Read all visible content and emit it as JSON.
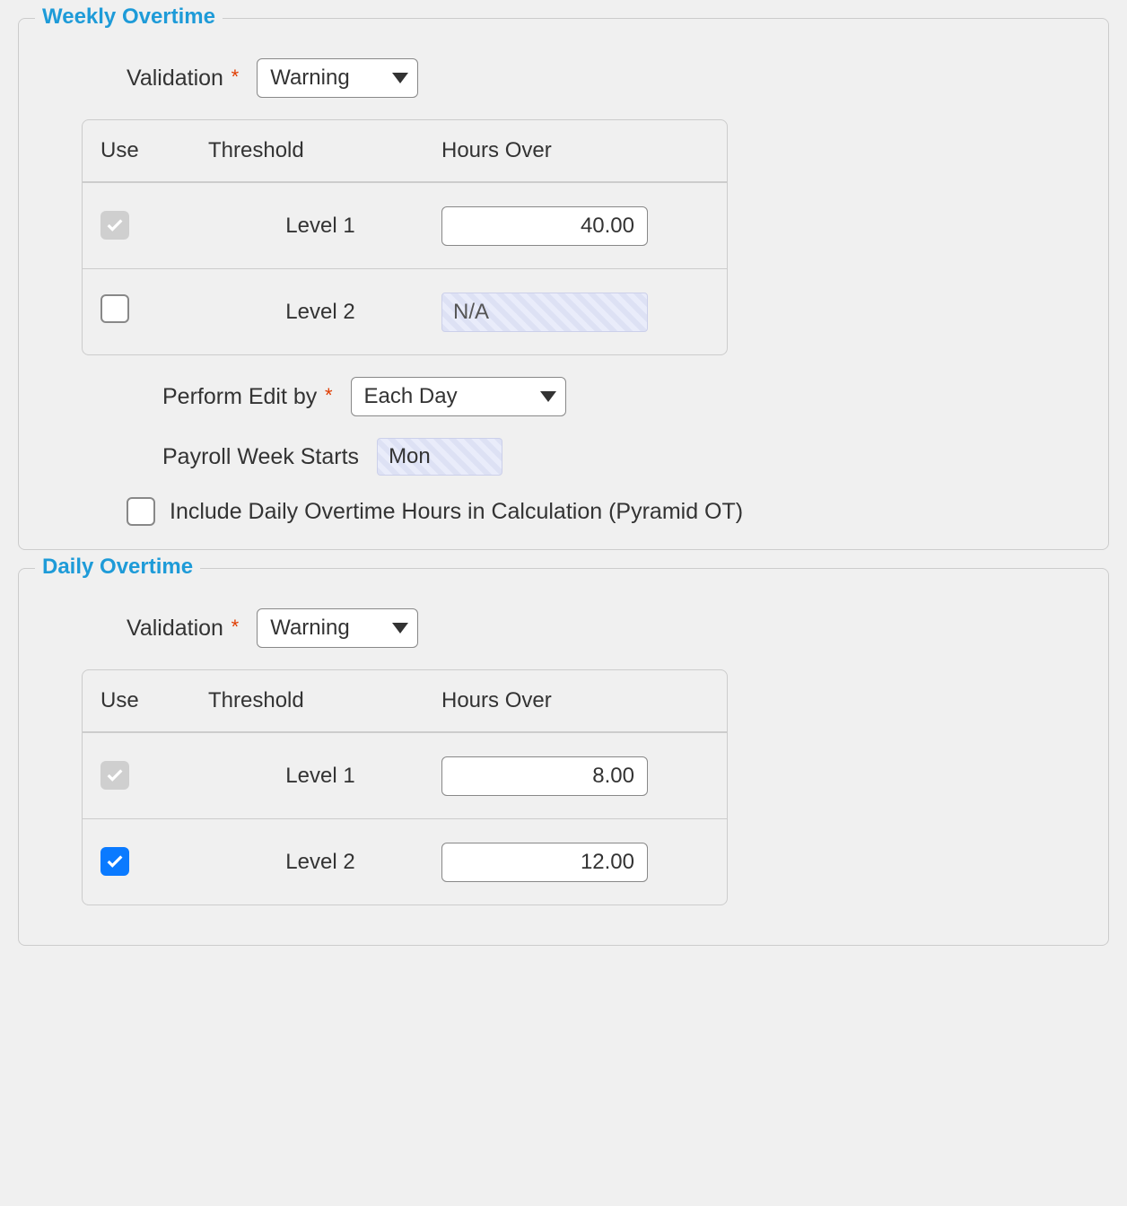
{
  "weekly_overtime": {
    "legend": "Weekly Overtime",
    "validation_label": "Validation",
    "validation_value": "Warning",
    "table": {
      "headers": {
        "use": "Use",
        "threshold": "Threshold",
        "hours_over": "Hours Over"
      },
      "rows": [
        {
          "threshold_label": "Level 1",
          "hours_value": "40.00",
          "na_text": ""
        },
        {
          "threshold_label": "Level 2",
          "hours_value": "",
          "na_text": "N/A"
        }
      ]
    },
    "perform_edit_by_label": "Perform Edit by",
    "perform_edit_by_value": "Each Day",
    "payroll_week_starts_label": "Payroll Week Starts",
    "payroll_week_starts_value": "Mon",
    "include_pyramid_label": "Include Daily Overtime Hours in Calculation (Pyramid OT)"
  },
  "daily_overtime": {
    "legend": "Daily Overtime",
    "validation_label": "Validation",
    "validation_value": "Warning",
    "table": {
      "headers": {
        "use": "Use",
        "threshold": "Threshold",
        "hours_over": "Hours Over"
      },
      "rows": [
        {
          "threshold_label": "Level 1",
          "hours_value": "8.00"
        },
        {
          "threshold_label": "Level 2",
          "hours_value": "12.00"
        }
      ]
    }
  }
}
